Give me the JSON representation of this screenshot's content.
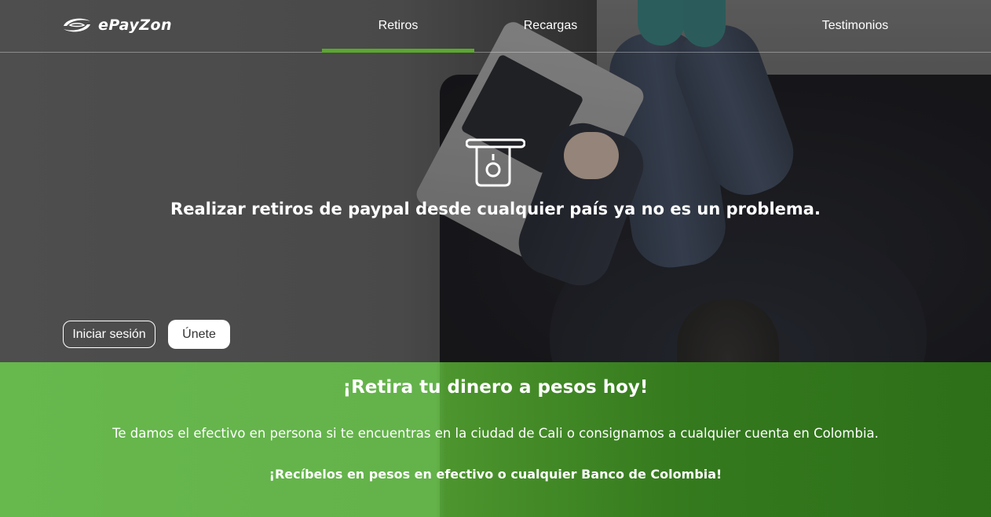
{
  "brand": {
    "name": "ePayZon",
    "logo_icon": "epayzon-swoosh-icon"
  },
  "nav": {
    "items": [
      {
        "label": "Retiros",
        "active": true
      },
      {
        "label": "Recargas",
        "active": false
      },
      {
        "label": "Testimonios",
        "active": false
      }
    ],
    "active_color": "#5aa82d"
  },
  "hero": {
    "icon": "atm-withdraw-icon",
    "headline": "Realizar retiros de paypal desde cualquier país ya no es un problema."
  },
  "auth": {
    "login_label": "Iniciar sesión",
    "join_label": "Únete"
  },
  "promo": {
    "title": "¡Retira tu dinero a pesos hoy!",
    "description": "Te damos el efectivo en persona si te encuentras en la ciudad de Cali o consignamos a cualquier cuenta en Colombia.",
    "cta": "¡Recíbelos en pesos en efectivo o cualquier Banco de Colombia!",
    "background_color": "#63b24a"
  }
}
